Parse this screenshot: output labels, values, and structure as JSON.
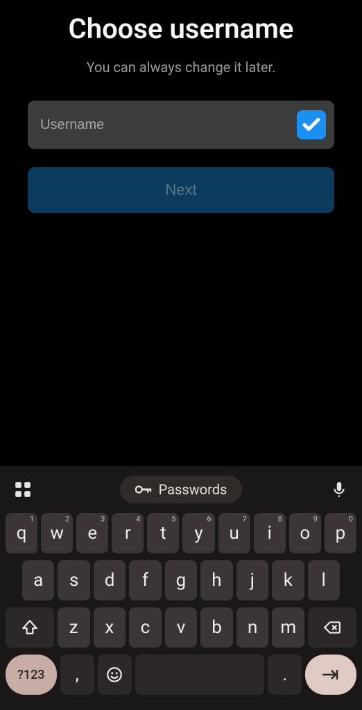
{
  "title": "Choose username",
  "subtitle": "You can always change it later.",
  "input": {
    "placeholder": "Username",
    "value": ""
  },
  "nextLabel": "Next",
  "keyboard": {
    "passwordsLabel": "Passwords",
    "row1": [
      "q",
      "w",
      "e",
      "r",
      "t",
      "y",
      "u",
      "i",
      "o",
      "p"
    ],
    "row1sup": [
      "1",
      "2",
      "3",
      "4",
      "5",
      "6",
      "7",
      "8",
      "9",
      "0"
    ],
    "row2": [
      "a",
      "s",
      "d",
      "f",
      "g",
      "h",
      "j",
      "k",
      "l"
    ],
    "row3": [
      "z",
      "x",
      "c",
      "v",
      "b",
      "n",
      "m"
    ],
    "symKey": "?123",
    "comma": ",",
    "period": "."
  }
}
